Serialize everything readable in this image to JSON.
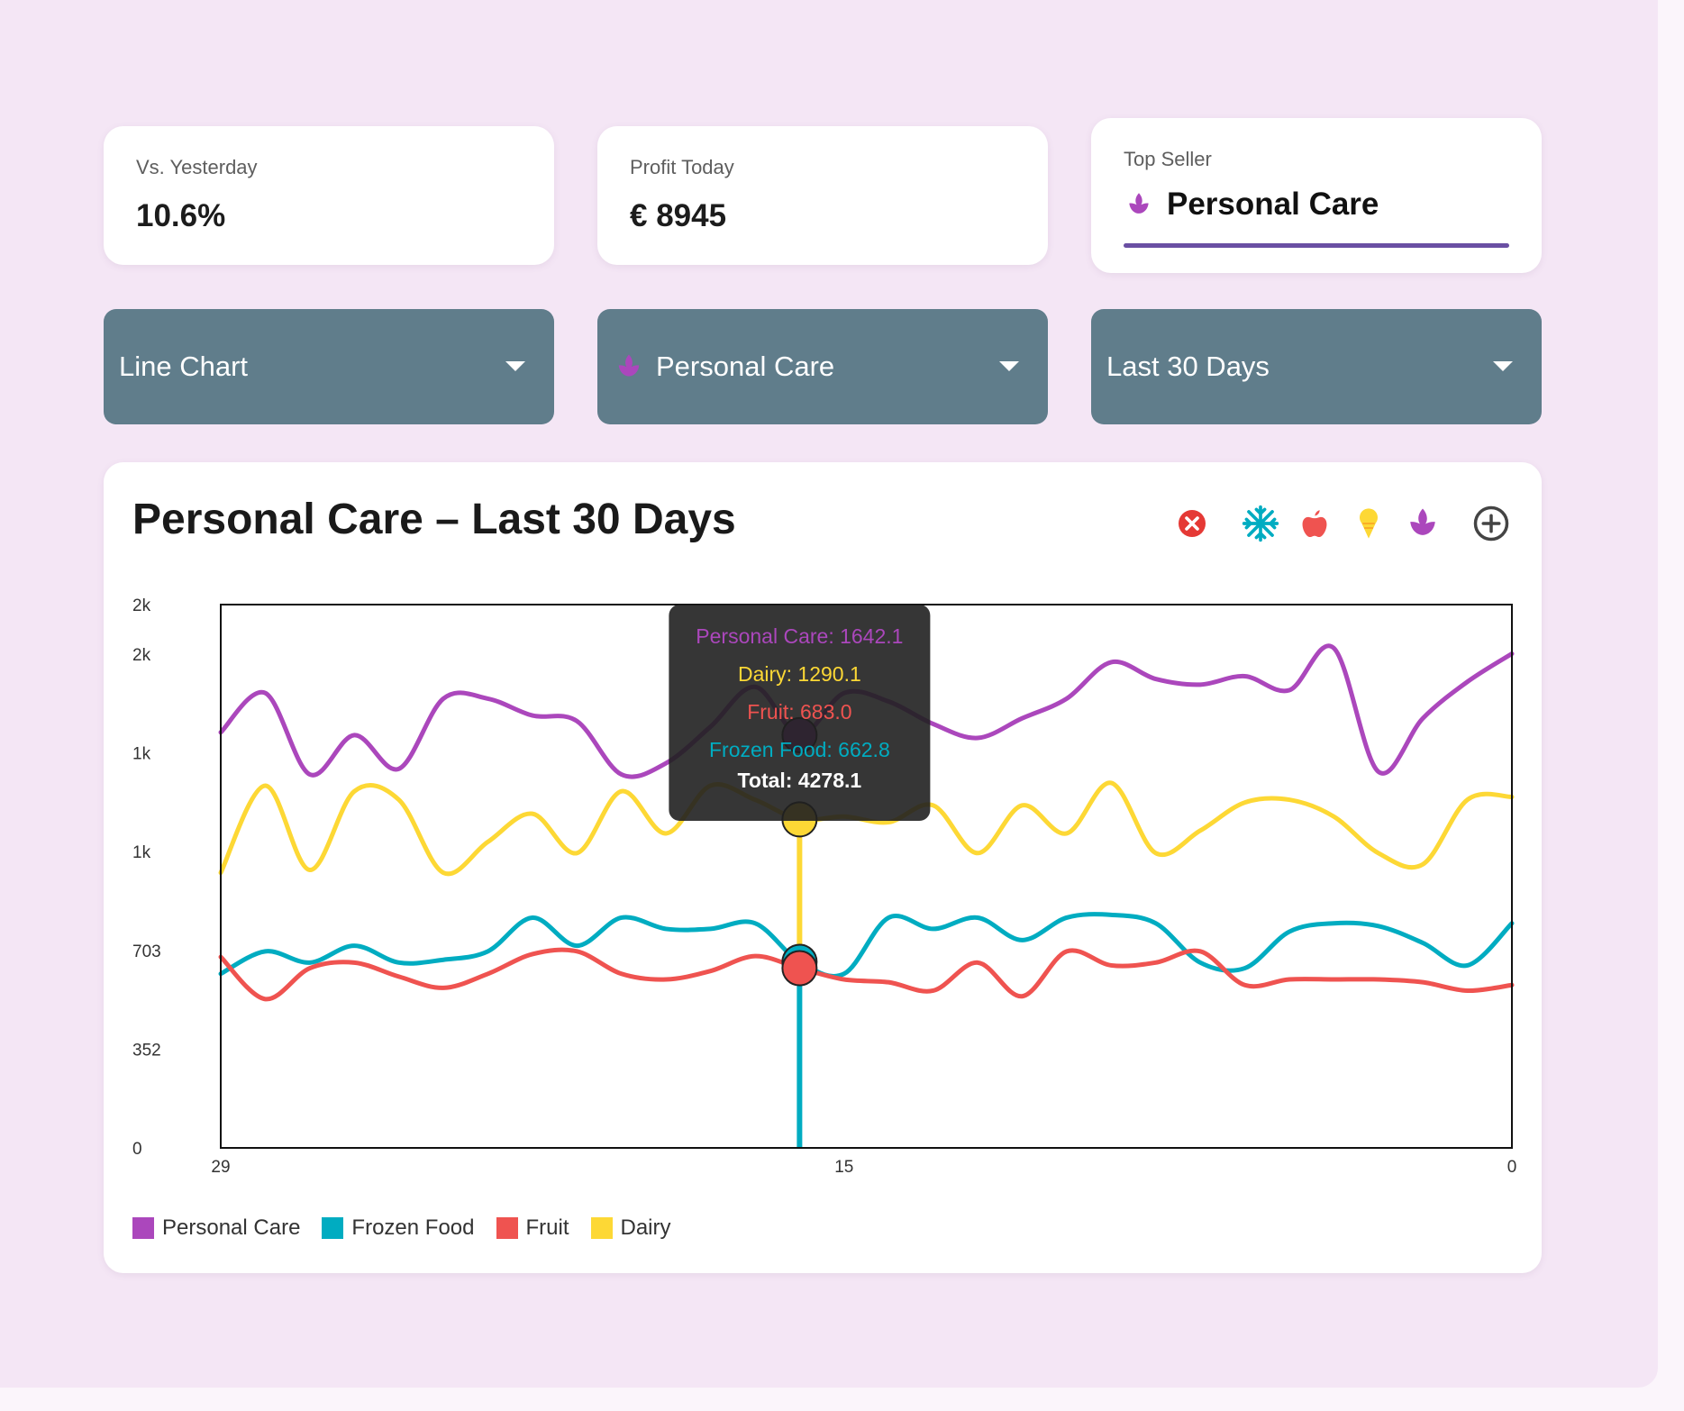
{
  "stats": {
    "vs_yesterday": {
      "label": "Vs. Yesterday",
      "value": "10.6%"
    },
    "profit_today": {
      "label": "Profit Today",
      "value": "€ 8945"
    },
    "top_seller": {
      "label": "Top Seller",
      "value": "Personal Care",
      "icon": "lotus-icon"
    }
  },
  "controls": {
    "chart_type": "Line Chart",
    "category": "Personal Care",
    "range": "Last 30 Days"
  },
  "toolbar": {
    "icons": [
      "close-circle-icon",
      "snowflake-icon",
      "apple-icon",
      "ice-cream-icon",
      "lotus-icon",
      "add-circle-icon"
    ]
  },
  "colors": {
    "personal_care": "#ab47bc",
    "frozen_food": "#00acc1",
    "fruit": "#ef5350",
    "dairy": "#fdd835",
    "select_bg": "#607d8b",
    "accent": "#6a4fa3",
    "page_bg": "#f4e6f5"
  },
  "chart_data": {
    "type": "line",
    "title": "Personal Care – Last 30 Days",
    "x": [
      29,
      28,
      27,
      26,
      25,
      24,
      23,
      22,
      21,
      20,
      19,
      18,
      17,
      16,
      15,
      14,
      13,
      12,
      11,
      10,
      9,
      8,
      7,
      6,
      5,
      4,
      3,
      2,
      1,
      0
    ],
    "x_ticks": [
      "29",
      "15",
      "0"
    ],
    "y_ticks": [
      {
        "value": 0,
        "label": "0"
      },
      {
        "value": 352,
        "label": "352"
      },
      {
        "value": 703,
        "label": "703"
      },
      {
        "value": 1055,
        "label": "1k"
      },
      {
        "value": 1407,
        "label": "1k"
      },
      {
        "value": 1758,
        "label": "2k"
      },
      {
        "value": 1935,
        "label": "2k"
      }
    ],
    "ylim": [
      0,
      1935
    ],
    "series": [
      {
        "name": "Personal Care",
        "key": "personal_care",
        "values": [
          1480,
          1620,
          1330,
          1470,
          1350,
          1600,
          1600,
          1540,
          1520,
          1330,
          1370,
          1500,
          1642.1,
          1470,
          1620,
          1590,
          1510,
          1460,
          1530,
          1600,
          1730,
          1670,
          1650,
          1680,
          1630,
          1780,
          1340,
          1530,
          1660,
          1760
        ]
      },
      {
        "name": "Frozen Food",
        "key": "frozen_food",
        "values": [
          620,
          700,
          660,
          720,
          660,
          670,
          700,
          820,
          720,
          820,
          780,
          780,
          800,
          662.8,
          620,
          820,
          780,
          820,
          740,
          820,
          830,
          800,
          660,
          640,
          770,
          800,
          790,
          730,
          650,
          800
        ]
      },
      {
        "name": "Fruit",
        "key": "fruit",
        "values": [
          680,
          530,
          640,
          660,
          610,
          570,
          620,
          690,
          700,
          620,
          600,
          630,
          683.0,
          640,
          600,
          590,
          560,
          660,
          540,
          700,
          650,
          660,
          700,
          580,
          600,
          600,
          600,
          590,
          560,
          580
        ]
      },
      {
        "name": "Dairy",
        "key": "dairy",
        "values": [
          980,
          1290,
          990,
          1270,
          1240,
          980,
          1090,
          1190,
          1050,
          1270,
          1120,
          1290.1,
          1240,
          1170,
          1180,
          1160,
          1220,
          1050,
          1220,
          1120,
          1300,
          1050,
          1130,
          1230,
          1240,
          1180,
          1050,
          1010,
          1240,
          1250
        ]
      }
    ],
    "tooltip": {
      "x": 16,
      "lines": [
        {
          "key": "personal_care",
          "text": "Personal Care: 1642.1"
        },
        {
          "key": "dairy",
          "text": "Dairy: 1290.1"
        },
        {
          "key": "fruit",
          "text": "Fruit: 683.0"
        },
        {
          "key": "frozen_food",
          "text": "Frozen Food: 662.8"
        },
        {
          "key": "total",
          "text": "Total: 4278.1"
        }
      ]
    },
    "legend": [
      "Personal Care",
      "Frozen Food",
      "Fruit",
      "Dairy"
    ],
    "grid": false,
    "legend_position": "bottom-left"
  }
}
